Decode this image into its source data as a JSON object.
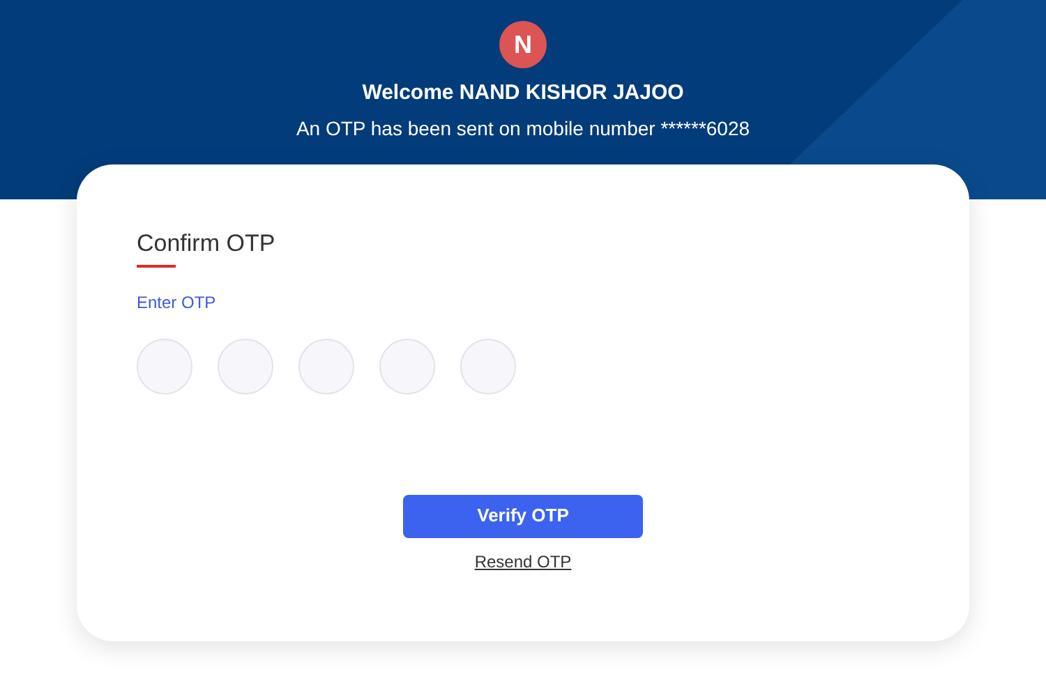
{
  "header": {
    "avatar_letter": "N",
    "welcome": "Welcome NAND KISHOR JAJOO",
    "message": "An OTP has been sent on mobile number ******6028"
  },
  "card": {
    "title": "Confirm OTP",
    "field_label": "Enter OTP",
    "otp_fields": [
      {
        "filled": false
      },
      {
        "filled": false
      },
      {
        "filled": false
      },
      {
        "filled": false
      },
      {
        "filled": false
      }
    ],
    "verify_button": "Verify OTP",
    "resend_link": "Resend OTP"
  }
}
